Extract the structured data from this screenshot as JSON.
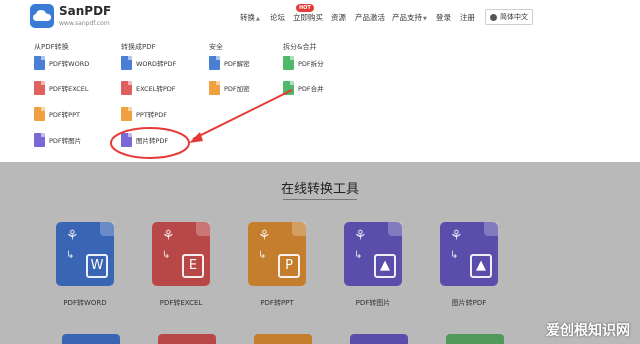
{
  "header": {
    "brand": "SanPDF",
    "domain": "www.sanpdf.com",
    "nav": [
      {
        "label": "转换",
        "has_caret": true
      },
      {
        "label": "论坛",
        "has_caret": false
      },
      {
        "label": "立即购买",
        "has_caret": false
      },
      {
        "label": "资源",
        "has_caret": false
      },
      {
        "label": "产品激活",
        "has_caret": false
      },
      {
        "label": "产品支持",
        "has_caret": true
      },
      {
        "label": "登录",
        "has_caret": false
      },
      {
        "label": "注册",
        "has_caret": false
      }
    ],
    "badge": "HOT",
    "language": "简体中文"
  },
  "dropdown": {
    "columns": [
      {
        "heading": "从PDF转换",
        "items": [
          {
            "label": "PDF转WORD",
            "color": "#4a7fd6"
          },
          {
            "label": "PDF转EXCEL",
            "color": "#e06060"
          },
          {
            "label": "PDF转PPT",
            "color": "#f0a040"
          },
          {
            "label": "PDF转图片",
            "color": "#7b68d6"
          }
        ]
      },
      {
        "heading": "转换成PDF",
        "items": [
          {
            "label": "WORD转PDF",
            "color": "#4a7fd6"
          },
          {
            "label": "EXCEL转PDF",
            "color": "#e06060"
          },
          {
            "label": "PPT转PDF",
            "color": "#f0a040"
          },
          {
            "label": "图片转PDF",
            "color": "#7b68d6"
          }
        ]
      },
      {
        "heading": "安全",
        "items": [
          {
            "label": "PDF解密",
            "color": "#4a7fd6"
          },
          {
            "label": "PDF加密",
            "color": "#f0a040"
          }
        ]
      },
      {
        "heading": "拆分&合并",
        "items": [
          {
            "label": "PDF拆分",
            "color": "#4fb86a"
          },
          {
            "label": "PDF合并",
            "color": "#4fb86a"
          }
        ]
      }
    ]
  },
  "tools_section": {
    "title": "在线转换工具",
    "tools": [
      {
        "label": "PDF转WORD",
        "letter": "W",
        "color": "#3a65b4"
      },
      {
        "label": "PDF转EXCEL",
        "letter": "E",
        "color": "#b84848"
      },
      {
        "label": "PDF转PPT",
        "letter": "P",
        "color": "#c47e2e"
      },
      {
        "label": "PDF转图片",
        "letter": "▲",
        "color": "#5a4eaa"
      },
      {
        "label": "图片转PDF",
        "letter": "▲",
        "color": "#5a4eaa"
      }
    ]
  },
  "watermark": "爱创根知识网",
  "colors": {
    "brand": "#3a7bd5",
    "highlight": "#e53935"
  }
}
